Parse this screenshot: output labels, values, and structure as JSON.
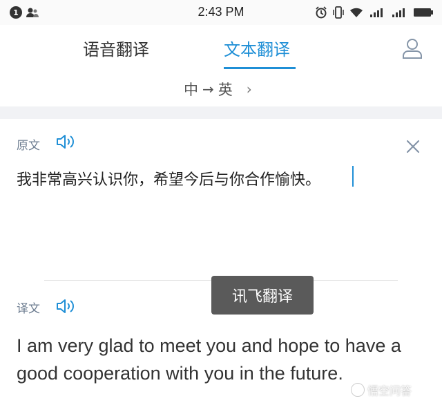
{
  "status_bar": {
    "notification_count": "1",
    "time": "2:43 PM",
    "icons": [
      "person-icon",
      "alarm-icon",
      "vibrate-icon",
      "wifi-icon",
      "signal-icon",
      "signal-icon",
      "battery-icon"
    ]
  },
  "tabs": [
    {
      "label": "语音翻译",
      "active": false
    },
    {
      "label": "文本翻译",
      "active": true
    }
  ],
  "language": {
    "source": "中",
    "target": "英",
    "arrow": "→",
    "chevron": "›"
  },
  "source": {
    "label": "原文",
    "text": "我非常高兴认识你，希望今后与你合作愉快。"
  },
  "target": {
    "label": "译文",
    "text": "I am very glad to meet you and hope to have a good cooperation with you in the future."
  },
  "toast": {
    "text": "讯飞翻译"
  },
  "watermark": {
    "text": "悟空问答"
  },
  "colors": {
    "accent": "#1f8fd6",
    "label": "#6c7c90",
    "toast_bg": "#5a5a5a"
  }
}
